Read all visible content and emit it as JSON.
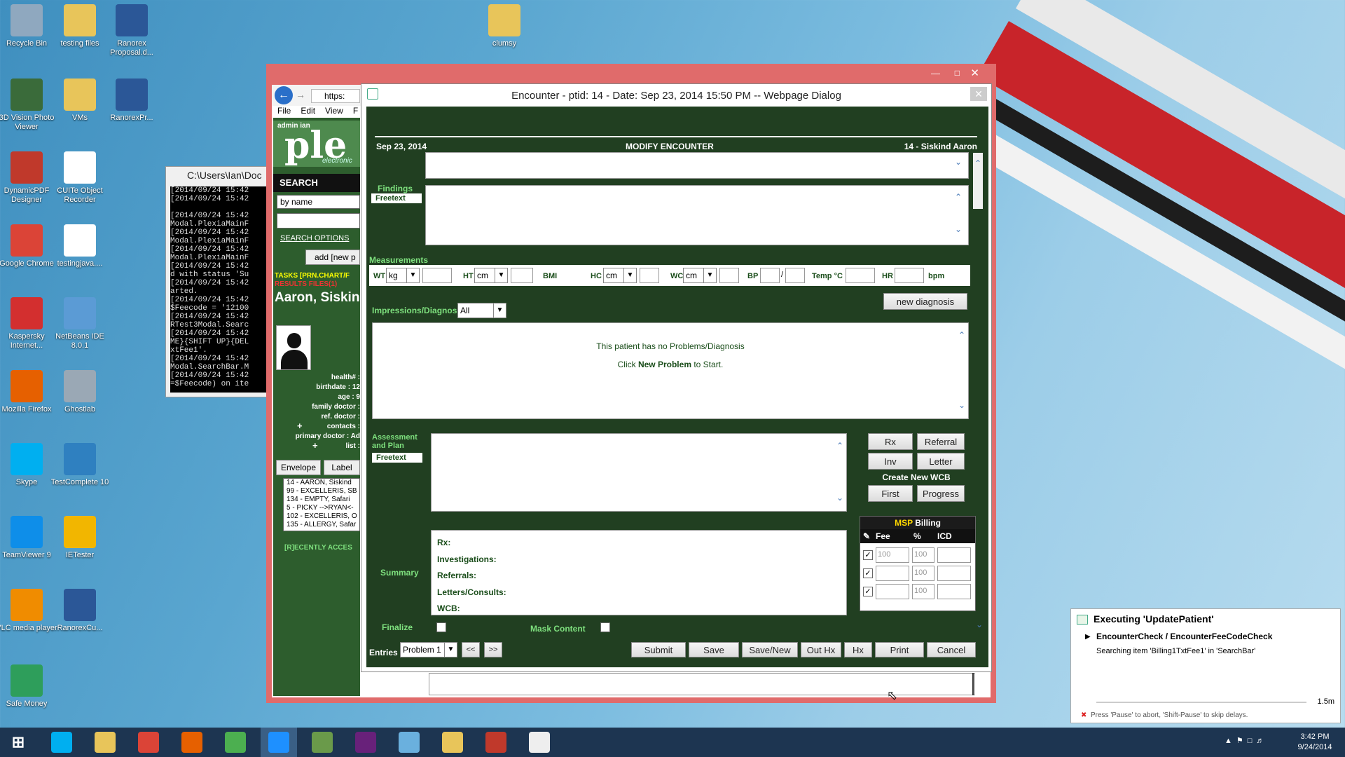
{
  "desktop": {
    "icons": [
      {
        "label": "Recycle Bin",
        "icon": "recycle-bin-icon",
        "color": "#8fa8bf"
      },
      {
        "label": "testing files",
        "icon": "folder-icon",
        "color": "#e8c55a"
      },
      {
        "label": "Ranorex Proposal.d...",
        "icon": "word-doc-icon",
        "color": "#2b5797"
      },
      {
        "label": "3D Vision Photo Viewer",
        "icon": "photo-viewer-icon",
        "color": "#3a6b3a"
      },
      {
        "label": "VMs",
        "icon": "folder-icon",
        "color": "#e8c55a"
      },
      {
        "label": "RanorexPr...",
        "icon": "word-doc-icon",
        "color": "#2b5797"
      },
      {
        "label": "DynamicPDF Designer",
        "icon": "pdf-designer-icon",
        "color": "#c0392b"
      },
      {
        "label": "CUITe Object Recorder",
        "icon": "cuite-icon",
        "color": "#ffffff"
      },
      {
        "label": "Google Chrome",
        "icon": "chrome-icon",
        "color": "#db4437"
      },
      {
        "label": "testingjava....",
        "icon": "file-icon",
        "color": "#ffffff"
      },
      {
        "label": "Kaspersky Internet...",
        "icon": "kaspersky-icon",
        "color": "#d32f2f"
      },
      {
        "label": "NetBeans IDE 8.0.1",
        "icon": "netbeans-icon",
        "color": "#5b9bd5"
      },
      {
        "label": "Mozilla Firefox",
        "icon": "firefox-icon",
        "color": "#e66000"
      },
      {
        "label": "Ghostlab",
        "icon": "ghostlab-icon",
        "color": "#9aa8b5"
      },
      {
        "label": "Skype",
        "icon": "skype-icon",
        "color": "#00aff0"
      },
      {
        "label": "TestComplete 10",
        "icon": "testcomplete-icon",
        "color": "#2f80c0"
      },
      {
        "label": "TeamViewer 9",
        "icon": "teamviewer-icon",
        "color": "#0e8ee9"
      },
      {
        "label": "IETester",
        "icon": "ietester-icon",
        "color": "#f2b600"
      },
      {
        "label": "VLC media player",
        "icon": "vlc-icon",
        "color": "#f08c00"
      },
      {
        "label": "RanorexCu...",
        "icon": "word-doc-icon",
        "color": "#2b5797"
      },
      {
        "label": "Safe Money",
        "icon": "safe-money-icon",
        "color": "#2e9e5b"
      },
      {
        "label": "clumsy",
        "icon": "folder-icon",
        "color": "#e8c55a"
      }
    ]
  },
  "console": {
    "title": "C:\\Users\\Ian\\Doc",
    "lines": "[2014/09/24 15:42\n[2014/09/24 15:42\n\n[2014/09/24 15:42\nModal.PlexiaMainF\n[2014/09/24 15:42\nModal.PlexiaMainF\n[2014/09/24 15:42\nModal.PlexiaMainF\n[2014/09/24 15:42\nd with status 'Su\n[2014/09/24 15:42\narted.\n[2014/09/24 15:42\n$Feecode = '12100\n[2014/09/24 15:42\nRTest3Modal.Searc\n[2014/09/24 15:42\nME}{SHIFT UP}{DEL\nxtFee1'.\n[2014/09/24 15:42\nModal.SearchBar.M\n[2014/09/24 15:42\n=$Feecode) on ite"
  },
  "browser": {
    "url": "https:",
    "menu": [
      "File",
      "Edit",
      "View",
      "F"
    ]
  },
  "left_panel": {
    "admin": "admin  ian",
    "logo": "ple",
    "logo_sub": "electronic",
    "search_title": "SEARCH",
    "search_by": "by name",
    "search_options": "SEARCH OPTIONS",
    "add_new": "add [new p",
    "tasks": "TASKS [PRN.CHART/F",
    "tasks2": "RESULTS  FILES(1)",
    "patient_name": "Aaron, Siskin",
    "info_labels": [
      "health# :",
      "birthdate : 12",
      "age : 9",
      "family doctor :",
      "ref. doctor :",
      "contacts :",
      "primary doctor : Ad",
      "list :"
    ],
    "envelope": "Envelope",
    "label": "Label",
    "recent": [
      "14 - AARON, Siskind",
      "99 - EXCELLERIS, SB",
      "134 - EMPTY, Safari",
      "5 - PICKY -->RYAN<-",
      "102 - EXCELLERIS, O",
      "135 - ALLERGY, Safar"
    ],
    "recently_accessed": "[R]ECENTLY ACCES"
  },
  "dialog": {
    "title": "Encounter - ptid: 14 - Date: Sep 23, 2014 15:50 PM -- Webpage Dialog",
    "date": "Sep 23, 2014",
    "heading": "MODIFY ENCOUNTER",
    "patient": "14 - Siskind Aaron",
    "findings": "Findings",
    "freetext": "Freetext",
    "measurements": "Measurements",
    "meas": {
      "wt": "WT",
      "kg": "kg",
      "ht": "HT",
      "cm": "cm",
      "bmi": "BMI",
      "hc": "HC",
      "wc": "WC",
      "bp": "BP",
      "bp_sep": "/",
      "temp": "Temp °C",
      "hr": "HR",
      "bpm": "bpm"
    },
    "impressions": "Impressions/Diagnosis",
    "impressions_filter": "All",
    "new_diagnosis": "new diagnosis",
    "no_problems": "This patient has no Problems/Diagnosis",
    "click_new_pre": "Click ",
    "click_new_bold": "New Problem",
    "click_new_post": " to Start.",
    "assessment": "Assessment and Plan",
    "buttons": {
      "rx": "Rx",
      "referral": "Referral",
      "inv": "Inv",
      "letter": "Letter",
      "create_wcb": "Create New WCB",
      "first": "First",
      "progress": "Progress"
    },
    "billing": {
      "title_msp": "MSP",
      "title_billing": "Billing",
      "fee": "Fee",
      "pct": "%",
      "icd": "ICD",
      "rows": [
        {
          "fee": "100",
          "pct": "100",
          "icd": ""
        },
        {
          "fee": "",
          "pct": "100",
          "icd": ""
        },
        {
          "fee": "",
          "pct": "100",
          "icd": ""
        }
      ]
    },
    "summary": "Summary",
    "summary_items": [
      "Rx:",
      "Investigations:",
      "Referrals:",
      "Letters/Consults:",
      "WCB:"
    ],
    "finalize": "Finalize",
    "mask": "Mask Content",
    "entries": "Entries",
    "problem": "Problem 1",
    "prev": "<<",
    "next": ">>",
    "actions": [
      "Submit",
      "Save",
      "Save/New",
      "Out Hx",
      "Hx",
      "Print",
      "Cancel"
    ]
  },
  "notification": {
    "title": "Executing 'UpdatePatient'",
    "step": "EncounterCheck / EncounterFeeCodeCheck",
    "detail": "Searching item 'Billing1TxtFee1' in 'SearchBar'",
    "timer": "1.5m",
    "footer": "Press 'Pause' to abort, 'Shift-Pause' to skip delays."
  },
  "taskbar": {
    "apps": [
      {
        "icon": "windows-start-icon",
        "color": "#1d3551"
      },
      {
        "icon": "skype-icon",
        "color": "#00aff0"
      },
      {
        "icon": "file-explorer-icon",
        "color": "#e8c55a"
      },
      {
        "icon": "chrome-icon",
        "color": "#db4437"
      },
      {
        "icon": "firefox-icon",
        "color": "#e66000"
      },
      {
        "icon": "nunit-icon",
        "color": "#4caf50"
      },
      {
        "icon": "internet-explorer-icon",
        "color": "#1e90ff"
      },
      {
        "icon": "app-cube-icon",
        "color": "#6a9a4a"
      },
      {
        "icon": "visual-studio-icon",
        "color": "#68217a"
      },
      {
        "icon": "ranorex-icon",
        "color": "#6ab0de"
      },
      {
        "icon": "folder-icon",
        "color": "#e8c55a"
      },
      {
        "icon": "snipping-tool-icon",
        "color": "#c0392b"
      },
      {
        "icon": "window-app-icon",
        "color": "#eeeeee"
      }
    ],
    "time": "3:42 PM",
    "date": "9/24/2014"
  }
}
